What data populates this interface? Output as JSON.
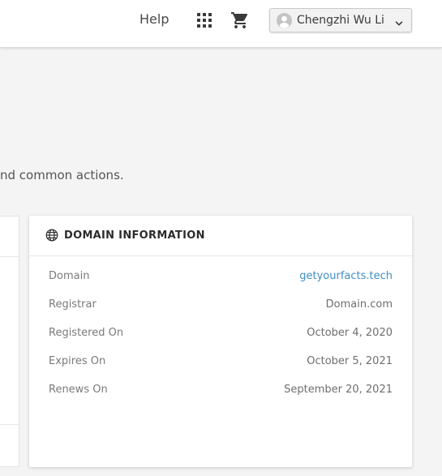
{
  "header": {
    "help_label": "Help",
    "apps_icon": "apps-grid-icon",
    "cart_icon": "shopping-cart-icon",
    "user": {
      "name": "Chengzhi Wu Li",
      "avatar_icon": "user-avatar-icon",
      "dropdown_icon": "chevron-down-icon"
    }
  },
  "intro": {
    "text": "nd common actions."
  },
  "domain_card": {
    "title": "DOMAIN INFORMATION",
    "icon": "globe-icon",
    "rows": [
      {
        "label": "Domain",
        "value": "getyourfacts.tech",
        "is_link": true
      },
      {
        "label": "Registrar",
        "value": "Domain.com",
        "is_link": false
      },
      {
        "label": "Registered On",
        "value": "October 4, 2020",
        "is_link": false
      },
      {
        "label": "Expires On",
        "value": "October 5, 2021",
        "is_link": false
      },
      {
        "label": "Renews On",
        "value": "September 20, 2021",
        "is_link": false
      }
    ]
  },
  "colors": {
    "link": "#3f8fc6",
    "page_bg": "#f4f4f4",
    "card_bg": "#ffffff"
  }
}
